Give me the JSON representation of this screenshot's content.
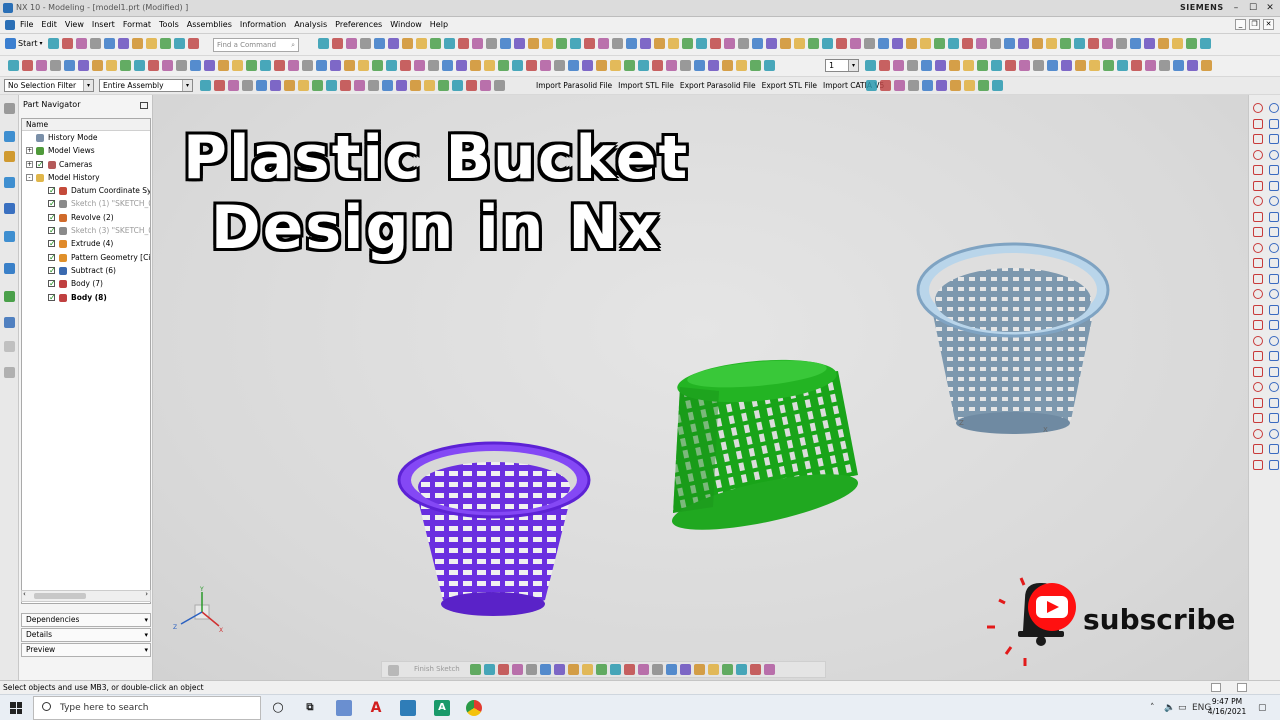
{
  "window": {
    "title": "NX 10 - Modeling - [model1.prt (Modified) ]",
    "brand": "SIEMENS"
  },
  "menu": {
    "items": [
      "File",
      "Edit",
      "View",
      "Insert",
      "Format",
      "Tools",
      "Assemblies",
      "Information",
      "Analysis",
      "Preferences",
      "Window",
      "Help"
    ]
  },
  "toolbar": {
    "start_label": "Start",
    "find_command_placeholder": "Find a Command",
    "layer_value": "1"
  },
  "selection_bar": {
    "filter_value": "No Selection Filter",
    "scope_value": "Entire Assembly",
    "cad_links": [
      "Import Parasolid File",
      "Import STL File",
      "Export Parasolid File",
      "Export STL File",
      "Import CATIA V5"
    ]
  },
  "navigator": {
    "title": "Part Navigator",
    "column_name": "Name",
    "tree": [
      {
        "label": "History Mode",
        "indent": 0,
        "expand": "",
        "check": false,
        "icon": "clock-icon",
        "icon_color": "#7a8fa8",
        "dim": false
      },
      {
        "label": "Model Views",
        "indent": 0,
        "expand": "+",
        "check": false,
        "icon": "views-icon",
        "icon_color": "#4f9a3a",
        "dim": false
      },
      {
        "label": "Cameras",
        "indent": 0,
        "expand": "+",
        "check": true,
        "icon": "camera-icon",
        "icon_color": "#b45a5a",
        "dim": false
      },
      {
        "label": "Model History",
        "indent": 0,
        "expand": "-",
        "check": false,
        "icon": "folder-icon",
        "icon_color": "#e0b64a",
        "dim": false
      },
      {
        "label": "Datum Coordinate Sy...",
        "indent": 1,
        "expand": "",
        "check": true,
        "icon": "datum-csys-icon",
        "icon_color": "#c44a3a",
        "dim": false
      },
      {
        "label": "Sketch (1) \"SKETCH_0...",
        "indent": 1,
        "expand": "",
        "check": true,
        "icon": "sketch-icon",
        "icon_color": "#8a8a8a",
        "dim": true
      },
      {
        "label": "Revolve (2)",
        "indent": 1,
        "expand": "",
        "check": true,
        "icon": "revolve-icon",
        "icon_color": "#d06a2a",
        "dim": false
      },
      {
        "label": "Sketch (3) \"SKETCH_0...",
        "indent": 1,
        "expand": "",
        "check": true,
        "icon": "sketch-icon",
        "icon_color": "#8a8a8a",
        "dim": true
      },
      {
        "label": "Extrude (4)",
        "indent": 1,
        "expand": "",
        "check": true,
        "icon": "extrude-icon",
        "icon_color": "#e08a2a",
        "dim": false
      },
      {
        "label": "Pattern Geometry [Ci...",
        "indent": 1,
        "expand": "",
        "check": true,
        "icon": "pattern-icon",
        "icon_color": "#e0902a",
        "dim": false
      },
      {
        "label": "Subtract (6)",
        "indent": 1,
        "expand": "",
        "check": true,
        "icon": "subtract-icon",
        "icon_color": "#3a6ab0",
        "dim": false
      },
      {
        "label": "Body (7)",
        "indent": 1,
        "expand": "",
        "check": true,
        "icon": "body-icon",
        "icon_color": "#c04040",
        "dim": false
      },
      {
        "label": "Body (8)",
        "indent": 1,
        "expand": "",
        "check": true,
        "icon": "body-icon",
        "icon_color": "#c04040",
        "dim": false
      }
    ],
    "panels": [
      "Dependencies",
      "Details",
      "Preview"
    ]
  },
  "viewport": {
    "title_line1": "Plastic Bucket",
    "title_line2": "Design in Nx",
    "subscribe": "subscribe",
    "sketch_bar_label": "Finish Sketch",
    "bucket_colors": {
      "purple": "#7a3ff0",
      "green": "#1fb01f",
      "blue": "#a9c8e0"
    }
  },
  "status": {
    "message": "Select objects and use MB3, or double-click an object"
  },
  "taskbar": {
    "search_placeholder": "Type here to search",
    "time": "9:47 PM",
    "date": "4/16/2021"
  }
}
